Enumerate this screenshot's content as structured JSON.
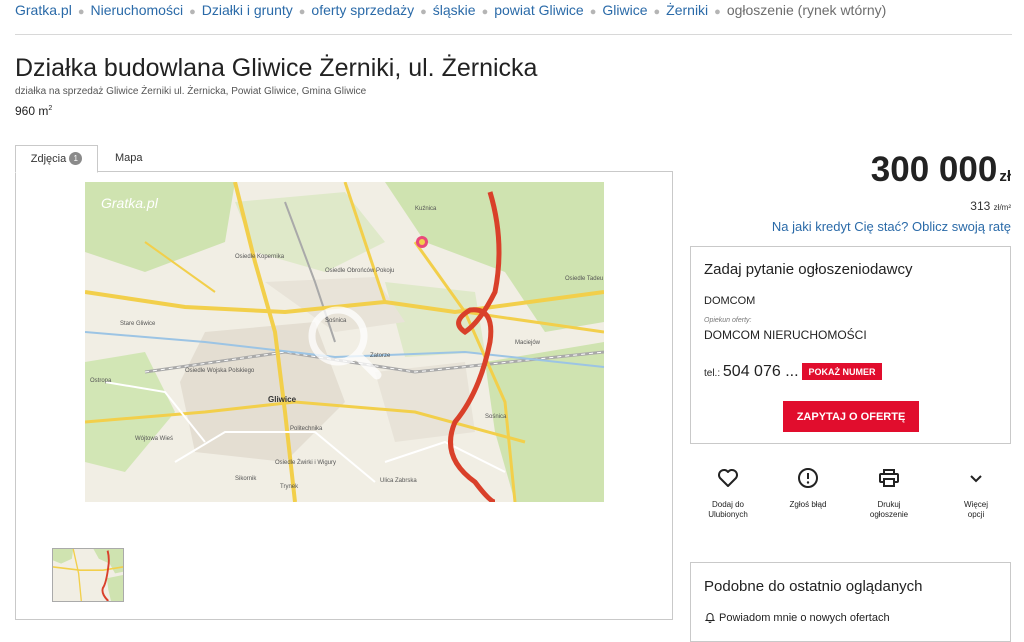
{
  "breadcrumb": {
    "items": [
      "Gratka.pl",
      "Nieruchomości",
      "Działki i grunty",
      "oferty sprzedaży",
      "śląskie",
      "powiat Gliwice",
      "Gliwice",
      "Żerniki"
    ],
    "current": "ogłoszenie (rynek wtórny)"
  },
  "listing": {
    "title": "Działka budowlana Gliwice Żerniki, ul. Żernicka",
    "subtitle": "działka na sprzedaż Gliwice Żerniki ul. Żernicka, Powiat Gliwice, Gmina Gliwice",
    "area_value": "960 m",
    "area_exp": "2"
  },
  "tabs": {
    "photos_label": "Zdjęcia",
    "photos_count": "1",
    "map_label": "Mapa"
  },
  "map_labels": {
    "watermark": "Gratka.pl",
    "kuznica": "Kuźnica",
    "koplinskie": "Osiedle Kopernika",
    "obroncow": "Osiedle Obrońców Pokoju",
    "stare": "Stare Gliwice",
    "sosnica": "Sośnica",
    "zatorze": "Zatorze",
    "wojska": "Osiedle Wojska Polskiego",
    "gliwice": "Gliwice",
    "ostropa": "Ostropa",
    "wojtowa": "Wójtowa Wieś",
    "zwirki": "Osiedle Żwirki i Wigury",
    "sikornik": "Sikornik",
    "trynek": "Trynek",
    "zabrska": "Ulica Zabrska",
    "sosnica2": "Sośnica",
    "maciejow": "Maciejów",
    "osiedle_tadeu": "Osiedle Tadeu",
    "politechnika": "Politechnika"
  },
  "price": {
    "value": "300 000",
    "currency": "zł",
    "per_m2": "313",
    "per_m2_unit": "zł/m²",
    "loan_link": "Na jaki kredyt Cię stać? Oblicz swoją ratę"
  },
  "contact": {
    "title": "Zadaj pytanie ogłoszeniodawcy",
    "agency": "DOMCOM",
    "caretaker_label": "Opiekun oferty:",
    "caretaker": "DOMCOM NIERUCHOMOŚCI",
    "tel_label": "tel.:",
    "tel_partial": "504 076 ...",
    "show_number": "POKAŻ NUMER",
    "ask_button": "ZAPYTAJ O OFERTĘ"
  },
  "actions": {
    "favorite_l1": "Dodaj do",
    "favorite_l2": "Ulubionych",
    "report": "Zgłoś błąd",
    "print_l1": "Drukuj",
    "print_l2": "ogłoszenie",
    "more_l1": "Więcej",
    "more_l2": "opcji"
  },
  "similar": {
    "title": "Podobne do ostatnio oglądanych",
    "notify": "Powiadom mnie o nowych ofertach"
  },
  "colors": {
    "link": "#2a6aa8",
    "accent_red": "#e10d2d",
    "route": "#d9402a",
    "map_road": "#f2cf4b"
  }
}
